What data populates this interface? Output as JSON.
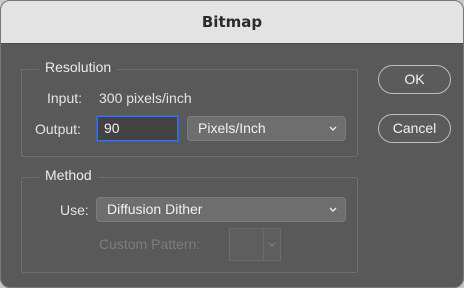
{
  "dialog": {
    "title": "Bitmap"
  },
  "resolution": {
    "legend": "Resolution",
    "input_label": "Input:",
    "input_value": "300 pixels/inch",
    "output_label": "Output:",
    "output_value": "90",
    "units_selected": "Pixels/Inch"
  },
  "method": {
    "legend": "Method",
    "use_label": "Use:",
    "use_selected": "Diffusion Dither",
    "custom_pattern_label": "Custom Pattern:"
  },
  "buttons": {
    "ok_label": "OK",
    "cancel_label": "Cancel"
  },
  "icons": {
    "dropdown": "chevron-down-icon"
  },
  "colors": {
    "titlebar": "#e3e3e3",
    "panel": "#595959",
    "focus_ring": "#3f6fd0"
  }
}
